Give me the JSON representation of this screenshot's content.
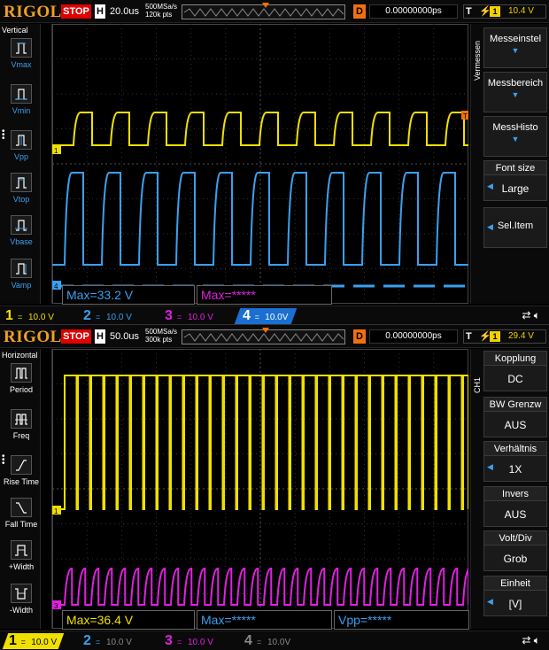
{
  "top": {
    "logo": "RIGOL",
    "run_state": "STOP",
    "h_label": "H",
    "timebase": "20.0us",
    "sample_rate": "500MSa/s",
    "mem_depth": "120k pts",
    "delay_label": "D",
    "delay": "0.00000000ps",
    "trig_label": "T",
    "trig_source": "1",
    "trig_level": "10.4 V",
    "left_menu": {
      "title": "Vertical",
      "items": [
        {
          "label": "Vmax",
          "icon": "vmax-icon"
        },
        {
          "label": "Vmin",
          "icon": "vmin-icon"
        },
        {
          "label": "Vpp",
          "icon": "vpp-icon"
        },
        {
          "label": "Vtop",
          "icon": "vtop-icon"
        },
        {
          "label": "Vbase",
          "icon": "vbase-icon"
        },
        {
          "label": "Vamp",
          "icon": "vamp-icon"
        }
      ]
    },
    "right_menu": {
      "title": "Vermessen",
      "buttons": [
        {
          "label": "Messeinstel"
        },
        {
          "label": "Messbereich"
        },
        {
          "label": "MessHisto"
        }
      ],
      "font_size": {
        "head": "Font size",
        "value": "Large"
      },
      "sel_item": "Sel.Item"
    },
    "measurements": [
      {
        "text": "Max=33.2 V",
        "color": "#3ba0f0"
      },
      {
        "text": "Max=*****",
        "color": "#e020e0"
      }
    ],
    "channels": [
      {
        "num": "1",
        "value": "10.0 V",
        "color": "#f0e000"
      },
      {
        "num": "2",
        "value": "10.0 V",
        "color": "#3ba0f0"
      },
      {
        "num": "3",
        "value": "10.0 V",
        "color": "#e020e0"
      },
      {
        "num": "4",
        "value": "10.0V",
        "color": "#3ba0f0"
      }
    ]
  },
  "bottom": {
    "logo": "RIGOL",
    "run_state": "STOP",
    "h_label": "H",
    "timebase": "50.0us",
    "sample_rate": "500MSa/s",
    "mem_depth": "300k pts",
    "delay_label": "D",
    "delay": "0.00000000ps",
    "trig_label": "T",
    "trig_source": "1",
    "trig_level": "29.4 V",
    "left_menu": {
      "title": "Horizontal",
      "items": [
        {
          "label": "Period",
          "icon": "period-icon"
        },
        {
          "label": "Freq",
          "icon": "freq-icon"
        },
        {
          "label": "Rise Time",
          "icon": "rise-time-icon"
        },
        {
          "label": "Fall Time",
          "icon": "fall-time-icon"
        },
        {
          "label": "+Width",
          "icon": "plus-width-icon"
        },
        {
          "label": "-Width",
          "icon": "minus-width-icon"
        }
      ]
    },
    "right_menu": {
      "title": "CH1",
      "groups": [
        {
          "head": "Kopplung",
          "value": "DC"
        },
        {
          "head": "BW Grenzw",
          "value": "AUS"
        },
        {
          "head": "Verhältnis",
          "value": "1X"
        },
        {
          "head": "Invers",
          "value": "AUS"
        },
        {
          "head": "Volt/Div",
          "value": "Grob"
        },
        {
          "head": "Einheit",
          "value": "[V]"
        }
      ]
    },
    "measurements": [
      {
        "text": "Max=36.4 V",
        "color": "#f0e000"
      },
      {
        "text": "Max=*****",
        "color": "#3ba0f0"
      },
      {
        "text": "Vpp=*****",
        "color": "#3ba0f0"
      }
    ],
    "channels": [
      {
        "num": "1",
        "value": "10.0 V",
        "color": "#f0e000"
      },
      {
        "num": "2",
        "value": "10.0 V",
        "color": "#3ba0f0"
      },
      {
        "num": "3",
        "value": "10.0 V",
        "color": "#e020e0"
      },
      {
        "num": "4",
        "value": "10.0V",
        "color": "#888888"
      }
    ]
  },
  "colors": {
    "ch1": "#f0e000",
    "ch2": "#3ba0f0",
    "ch3": "#e020e0",
    "trigger": "#f07010",
    "stop": "#e00000",
    "logo": "#f0a020"
  },
  "icons": {
    "speaker": "speaker-icon",
    "usb": "usb-icon"
  }
}
